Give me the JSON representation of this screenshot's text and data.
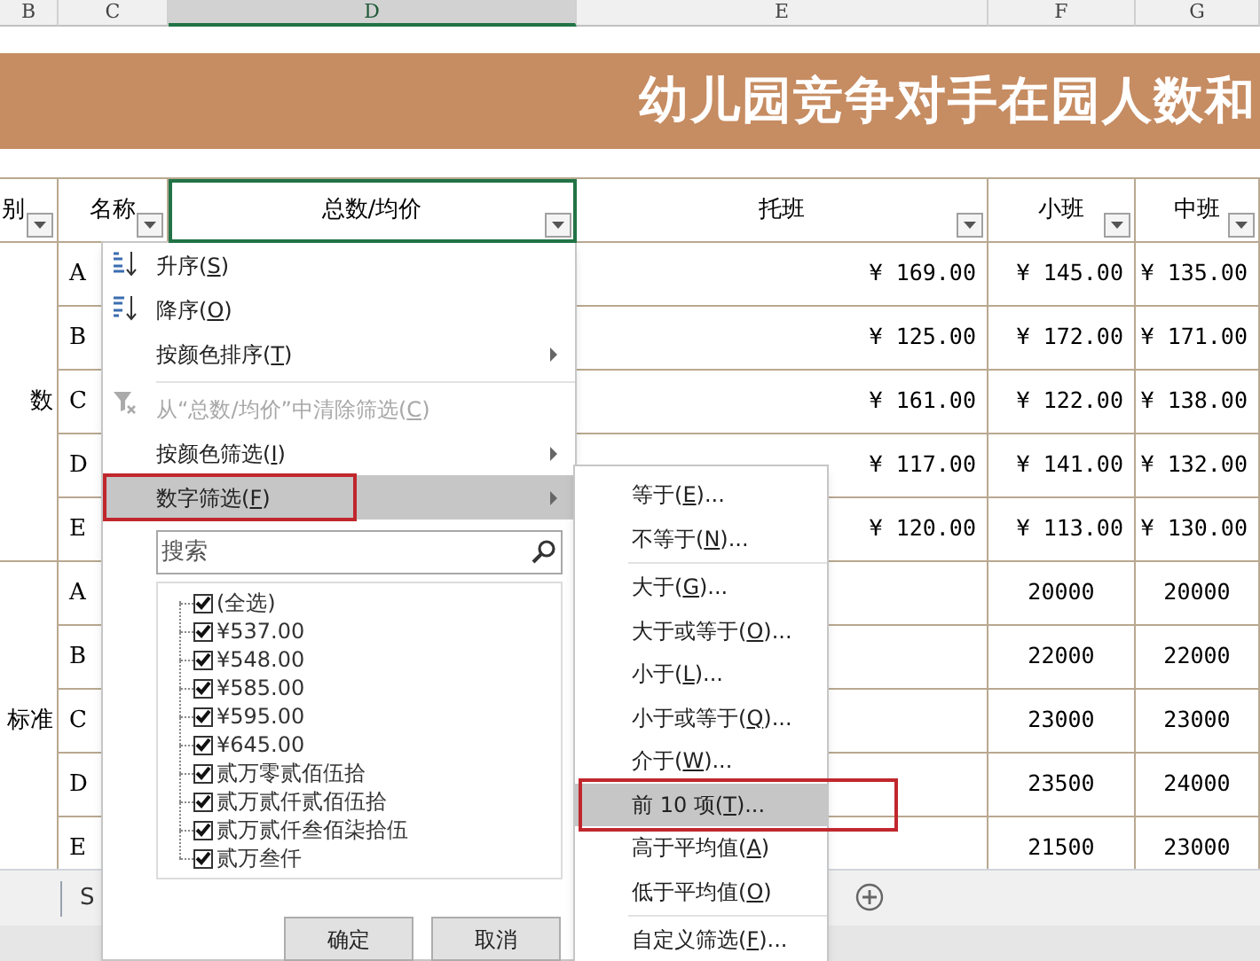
{
  "column_headers": [
    {
      "label": "B",
      "selected": false
    },
    {
      "label": "C",
      "selected": false
    },
    {
      "label": "D",
      "selected": true
    },
    {
      "label": "E",
      "selected": false
    },
    {
      "label": "F",
      "selected": false
    },
    {
      "label": "G",
      "selected": false
    }
  ],
  "title": "幼儿园竞争对手在园人数和",
  "table": {
    "headers": [
      {
        "text": "别",
        "selected": false
      },
      {
        "text": "名称",
        "selected": false
      },
      {
        "text": "总数/均价",
        "selected": true
      },
      {
        "text": "托班",
        "selected": false
      },
      {
        "text": "小班",
        "selected": false
      },
      {
        "text": "中班",
        "selected": false
      }
    ],
    "groups": [
      {
        "label": "数",
        "rows": [
          {
            "name": "A",
            "cells": [
              "¥ 169.00",
              "¥ 145.00",
              "¥ 135.00"
            ]
          },
          {
            "name": "B",
            "cells": [
              "¥ 125.00",
              "¥ 172.00",
              "¥ 171.00"
            ]
          },
          {
            "name": "C",
            "cells": [
              "¥ 161.00",
              "¥ 122.00",
              "¥ 138.00"
            ]
          },
          {
            "name": "D",
            "cells": [
              "¥ 117.00",
              "¥ 141.00",
              "¥ 132.00"
            ]
          },
          {
            "name": "E",
            "cells": [
              "¥ 120.00",
              "¥ 113.00",
              "¥ 130.00"
            ]
          }
        ]
      },
      {
        "label": "标准",
        "rows": [
          {
            "name": "A",
            "cells": [
              null,
              "20000",
              "20000"
            ]
          },
          {
            "name": "B",
            "cells": [
              null,
              "22000",
              "22000"
            ]
          },
          {
            "name": "C",
            "cells": [
              null,
              "23000",
              "23000"
            ]
          },
          {
            "name": "D",
            "cells": [
              null,
              "23500",
              "24000"
            ]
          },
          {
            "name": "E",
            "cells": [
              null,
              "21500",
              "23000"
            ]
          }
        ]
      }
    ]
  },
  "sheet_tabs": [
    {
      "label": "S"
    }
  ],
  "filter_menu": {
    "items": [
      {
        "kind": "sort-asc",
        "text": "升序(S)",
        "disabled": false,
        "submenu": false,
        "selected": false,
        "outlined": false,
        "separator_before": false
      },
      {
        "kind": "sort-desc",
        "text": "降序(O)",
        "disabled": false,
        "submenu": false,
        "selected": false,
        "outlined": false,
        "separator_before": false
      },
      {
        "kind": "item",
        "text": "按颜色排序(T)",
        "disabled": false,
        "submenu": true,
        "selected": false,
        "outlined": false,
        "separator_before": false
      },
      {
        "kind": "clear",
        "text": "从“总数/均价”中清除筛选(C)",
        "disabled": true,
        "submenu": false,
        "selected": false,
        "outlined": false,
        "separator_before": true
      },
      {
        "kind": "item",
        "text": "按颜色筛选(I)",
        "disabled": false,
        "submenu": true,
        "selected": false,
        "outlined": false,
        "separator_before": false
      },
      {
        "kind": "item",
        "text": "数字筛选(F)",
        "disabled": false,
        "submenu": true,
        "selected": true,
        "outlined": true,
        "separator_before": false
      }
    ],
    "search": {
      "placeholder": "搜索"
    },
    "values": [
      {
        "text": "(全选)",
        "checked": true
      },
      {
        "text": "¥537.00",
        "checked": true
      },
      {
        "text": "¥548.00",
        "checked": true
      },
      {
        "text": "¥585.00",
        "checked": true
      },
      {
        "text": "¥595.00",
        "checked": true
      },
      {
        "text": "¥645.00",
        "checked": true
      },
      {
        "text": "贰万零贰佰伍拾",
        "checked": true
      },
      {
        "text": "贰万贰仟贰佰伍拾",
        "checked": true
      },
      {
        "text": "贰万贰仟叁佰柒拾伍",
        "checked": true
      },
      {
        "text": "贰万叁仟",
        "checked": true
      }
    ],
    "buttons": [
      "确定",
      "取消"
    ]
  },
  "number_filter_menu": {
    "items": [
      {
        "text": "等于(E)...",
        "selected": false,
        "outlined": false,
        "separator_before": false
      },
      {
        "text": "不等于(N)...",
        "selected": false,
        "outlined": false,
        "separator_before": false
      },
      {
        "text": "大于(G)...",
        "selected": false,
        "outlined": false,
        "separator_before": true
      },
      {
        "text": "大于或等于(O)...",
        "selected": false,
        "outlined": false,
        "separator_before": false
      },
      {
        "text": "小于(L)...",
        "selected": false,
        "outlined": false,
        "separator_before": false
      },
      {
        "text": "小于或等于(Q)...",
        "selected": false,
        "outlined": false,
        "separator_before": false
      },
      {
        "text": "介于(W)...",
        "selected": false,
        "outlined": false,
        "separator_before": false
      },
      {
        "text": "前 10 项(T)...",
        "selected": true,
        "outlined": true,
        "separator_before": false
      },
      {
        "text": "高于平均值(A)",
        "selected": false,
        "outlined": false,
        "separator_before": false
      },
      {
        "text": "低于平均值(O)",
        "selected": false,
        "outlined": false,
        "separator_before": false
      },
      {
        "text": "自定义筛选(F)...",
        "selected": false,
        "outlined": false,
        "separator_before": true
      }
    ]
  }
}
